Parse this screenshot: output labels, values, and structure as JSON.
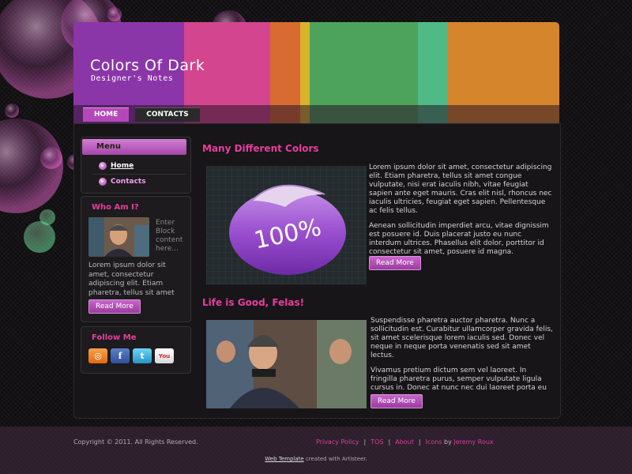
{
  "header": {
    "title": "Colors Of Dark",
    "slogan": "Designer's Notes",
    "stripes": [
      "#8b36a8",
      "#d3458f",
      "#d86b32",
      "#d9b42a",
      "#4da35c",
      "#4fba86",
      "#d5852b"
    ]
  },
  "nav": {
    "items": [
      {
        "label": "HOME",
        "active": true
      },
      {
        "label": "CONTACTS",
        "active": false
      }
    ]
  },
  "sidebar": {
    "menu": {
      "title": "Menu",
      "items": [
        {
          "label": "Home"
        },
        {
          "label": "Contacts"
        }
      ]
    },
    "who": {
      "title": "Who Am I?",
      "side_text": "Enter Block content here...",
      "text": "Lorem ipsum dolor sit amet, consectetur adipiscing elit. Etiam pharetra, tellus sit amet congue.",
      "button": "Read More"
    },
    "follow": {
      "title": "Follow Me",
      "icons": [
        "rss-icon",
        "facebook-icon",
        "twitter-icon",
        "youtube-icon"
      ],
      "icon_glyphs": [
        "◎",
        "f",
        "t",
        "You"
      ]
    }
  },
  "posts": [
    {
      "title": "Many Different Colors",
      "image_label": "100%",
      "paragraphs": [
        "Lorem ipsum dolor sit amet, consectetur adipiscing elit. Etiam pharetra, tellus sit amet congue vulputate, nisi erat iaculis nibh, vitae feugiat sapien ante eget mauris. Cras elit nisl, rhoncus nec iaculis ultricies, feugiat eget sapien. Pellentesque ac felis tellus.",
        "Aenean sollicitudin imperdiet arcu, vitae dignissim est posuere id. Duis placerat justo eu nunc interdum ultrices. Phasellus elit dolor, porttitor id consectetur sit amet, posuere id magna."
      ],
      "button": "Read More"
    },
    {
      "title": "Life is Good, Felas!",
      "paragraphs": [
        "Suspendisse pharetra auctor pharetra. Nunc a sollicitudin est. Curabitur ullamcorper gravida felis, sit amet scelerisque lorem iaculis sed. Donec vel neque in neque porta venenatis sed sit amet lectus.",
        "Vivamus pretium dictum sem vel laoreet. In fringilla pharetra purus, semper vulputate ligula cursus in. Donec at nunc nec dui laoreet porta eu eu ipsum."
      ],
      "button": "Read More"
    }
  ],
  "footer": {
    "copyright": "Copyright © 2011. All Rights Reserved.",
    "links": [
      "Privacy Policy",
      "TOS",
      "About",
      "Icons"
    ],
    "by_word": "by",
    "author": "Jeremy Roux",
    "credit_link": "Web Template",
    "credit_text": "created with Artisteer."
  },
  "colors": {
    "accent": "#e83d9f",
    "button": "#b04fb4",
    "background": "#141214"
  }
}
